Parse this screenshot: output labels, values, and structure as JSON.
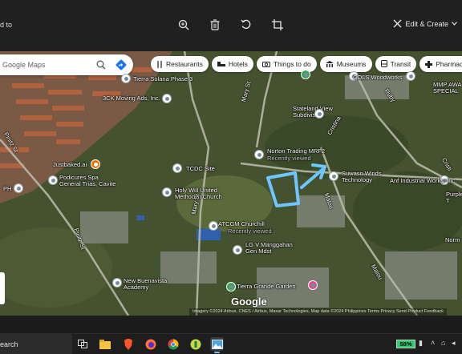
{
  "viewer": {
    "title": "d to",
    "tools": [
      "zoom-in-icon",
      "delete-icon",
      "rotate-icon",
      "crop-icon"
    ],
    "edit_create_label": "Edit & Create"
  },
  "map": {
    "search_placeholder": "Google Maps",
    "chips": [
      {
        "icon": "restaurant-icon",
        "label": "Restaurants"
      },
      {
        "icon": "hotel-icon",
        "label": "Hotels"
      },
      {
        "icon": "camera-icon",
        "label": "Things to do"
      },
      {
        "icon": "museum-icon",
        "label": "Museums"
      },
      {
        "icon": "transit-icon",
        "label": "Transit"
      },
      {
        "icon": "pharmacy-icon",
        "label": "Pharmacies"
      }
    ],
    "places": {
      "tierra_solana": "Tierra Solana Phase 3",
      "moving_ads": "3CK Moving Ads, Inc.",
      "stateland": "Stateland View\nSubdivision",
      "cols": "COLS Woodworks",
      "mmp": "MMP AWA\nSPECIAL",
      "norton": "Norton Trading MRF2",
      "norton_sub": "Recently viewed",
      "justbaked": "Justbaked.ai",
      "podicures": "Podicures Spa\nGeneral Trias, Cavite",
      "tcdc": "TCDC Site",
      "holy_will": "Holy Will United\nMethodist Church",
      "suwaso": "Suwaso Winds\nTechnology",
      "anf": "Anf Industrial Works, Inc.",
      "purple": "Purple\nT",
      "atcgm": "ATCGM Churchill",
      "atcgm_sub": "Recently viewed",
      "lgv": "LG V Manggahan\nGen Mdst",
      "normal": "Norm",
      "new_buena": "New Buenavista\nAcademy",
      "tierra_grande": "Tierra Grande Garden",
      "ph": "PH",
      "google": "Google"
    },
    "streets": {
      "pinitz_1": "Pinitz St",
      "pinitz_2": "Pinitz St",
      "mary_1": "Mary St",
      "mary_2": "Mary St",
      "cristina": "Cristina",
      "ruby": "Ruby",
      "malou_1": "Malou",
      "malou_2": "Malou",
      "cristi": "Cristi"
    },
    "attribution": "Imagery ©2024 Airbus, CNES / Airbus, Maxar Technologies, Map data ©2024   Philippines   Terms   Privacy   Send Product Feedback",
    "annotation_color": "#6ec6ff"
  },
  "taskbar": {
    "search_label": "earch",
    "apps": [
      "task-view-icon",
      "file-explorer-icon",
      "brave-icon",
      "firefox-icon",
      "chrome-icon",
      "app-icon",
      "photos-icon"
    ],
    "battery": "58%"
  }
}
